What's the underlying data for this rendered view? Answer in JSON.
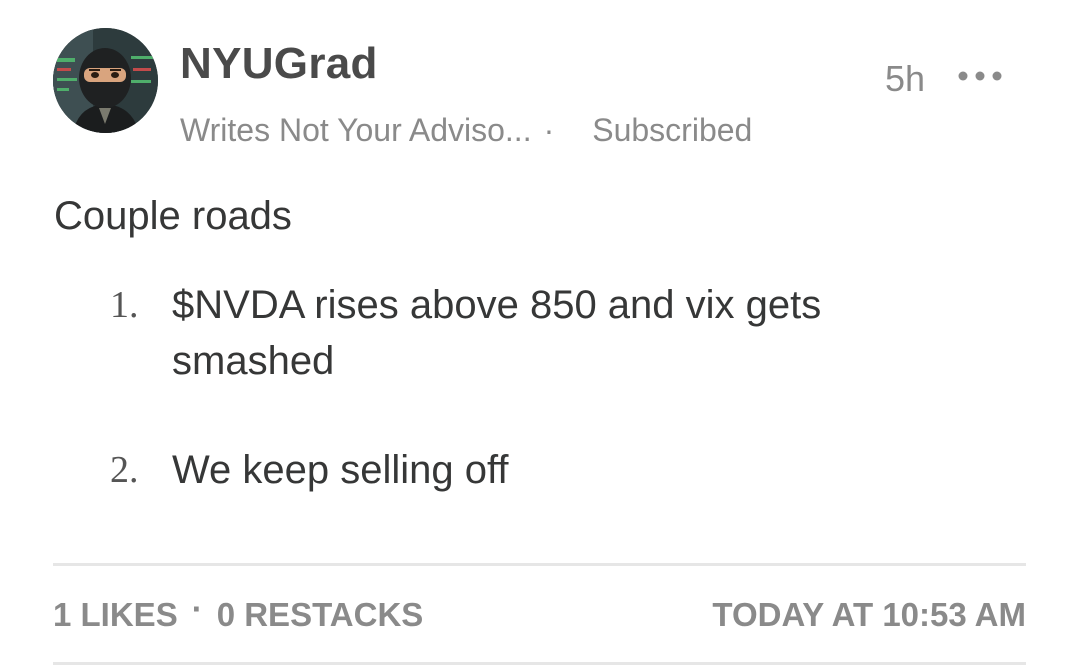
{
  "author": {
    "name": "NYUGrad",
    "avatar_icon": "ninja-avatar-icon"
  },
  "byline": {
    "publication": "Writes Not Your Adviso...",
    "separator": "·",
    "subscription_status": "Subscribed"
  },
  "meta": {
    "relative_time": "5h",
    "more_icon": "more-horizontal-icon"
  },
  "post": {
    "intro": "Couple roads",
    "items": [
      {
        "number": "1.",
        "text": "$NVDA rises above 850 and vix gets smashed"
      },
      {
        "number": "2.",
        "text": "We keep selling off"
      }
    ]
  },
  "footer": {
    "likes": "1 LIKES",
    "separator": "·",
    "restacks": "0 RESTACKS",
    "timestamp": "TODAY AT 10:53 AM"
  },
  "colors": {
    "text_primary": "#363737",
    "text_secondary": "#8a8a8a",
    "divider": "#e6e6e6"
  }
}
